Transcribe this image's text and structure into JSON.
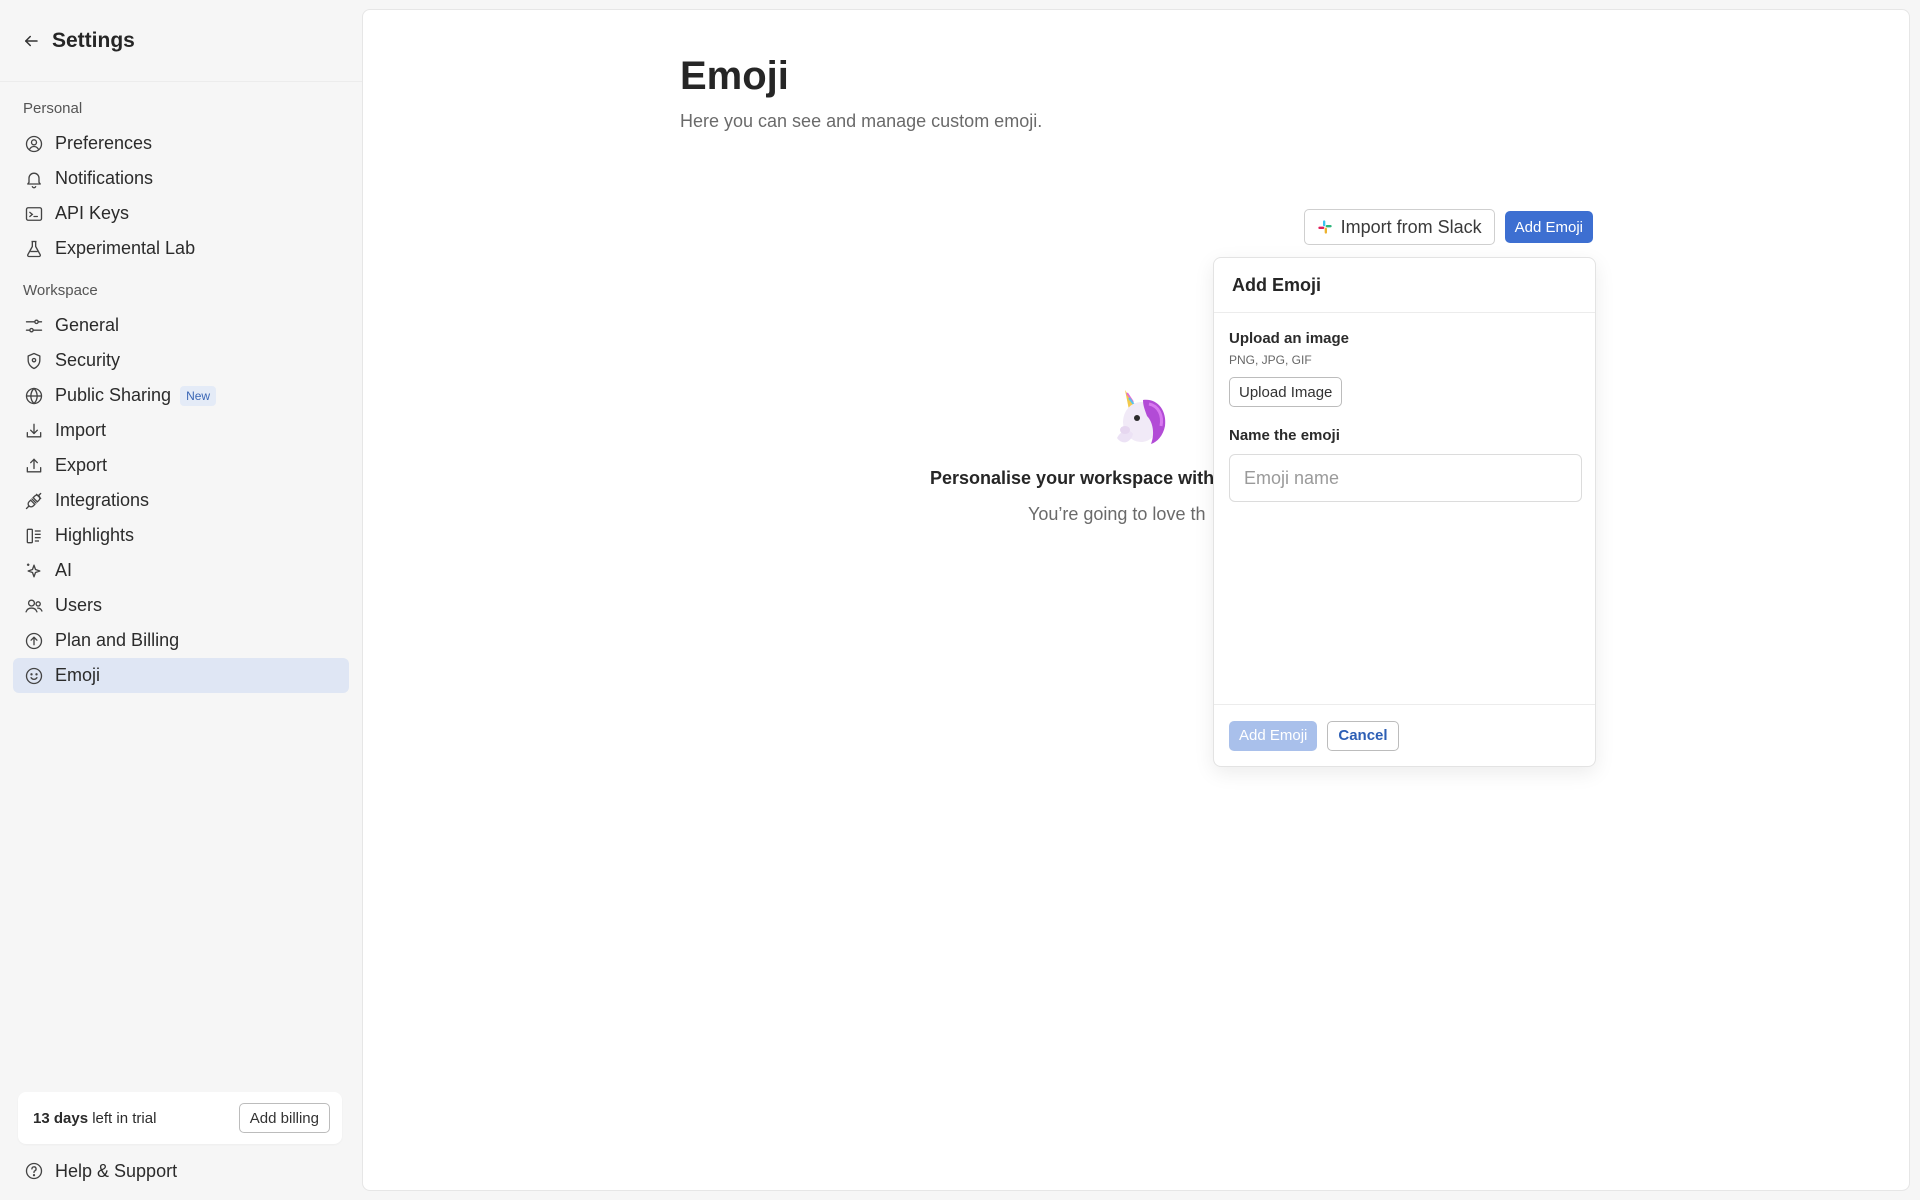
{
  "sidebar": {
    "title": "Settings",
    "sections": {
      "personal": "Personal",
      "workspace": "Workspace"
    },
    "personal_items": [
      {
        "label": "Preferences",
        "icon": "user-circle-icon"
      },
      {
        "label": "Notifications",
        "icon": "bell-icon"
      },
      {
        "label": "API Keys",
        "icon": "terminal-icon"
      },
      {
        "label": "Experimental Lab",
        "icon": "flask-icon"
      }
    ],
    "workspace_items": [
      {
        "label": "General",
        "icon": "sliders-icon"
      },
      {
        "label": "Security",
        "icon": "shield-icon"
      },
      {
        "label": "Public Sharing",
        "icon": "globe-icon",
        "badge": "New"
      },
      {
        "label": "Import",
        "icon": "import-icon"
      },
      {
        "label": "Export",
        "icon": "export-icon"
      },
      {
        "label": "Integrations",
        "icon": "plug-icon"
      },
      {
        "label": "Highlights",
        "icon": "highlights-icon"
      },
      {
        "label": "AI",
        "icon": "sparkle-icon"
      },
      {
        "label": "Users",
        "icon": "users-icon"
      },
      {
        "label": "Plan and Billing",
        "icon": "billing-icon"
      },
      {
        "label": "Emoji",
        "icon": "smiley-icon",
        "active": true
      }
    ],
    "trial": {
      "days": "13 days",
      "rest": " left in trial",
      "button": "Add billing"
    },
    "help": "Help & Support"
  },
  "main": {
    "title": "Emoji",
    "subtitle": "Here you can see and manage custom emoji.",
    "import_button": "Import from Slack",
    "add_button": "Add Emoji",
    "empty": {
      "title": "Personalise your workspace with",
      "subtitle": "You’re going to love th"
    }
  },
  "popup": {
    "title": "Add Emoji",
    "upload_label": "Upload an image",
    "upload_hint": "PNG, JPG, GIF",
    "upload_button": "Upload Image",
    "name_label": "Name the emoji",
    "name_placeholder": "Emoji name",
    "name_value": "",
    "submit_button": "Add Emoji",
    "cancel_button": "Cancel"
  },
  "colors": {
    "accent": "#3d6fd1",
    "active_nav": "#dfe6f4",
    "badge_text": "#3a66b5"
  }
}
